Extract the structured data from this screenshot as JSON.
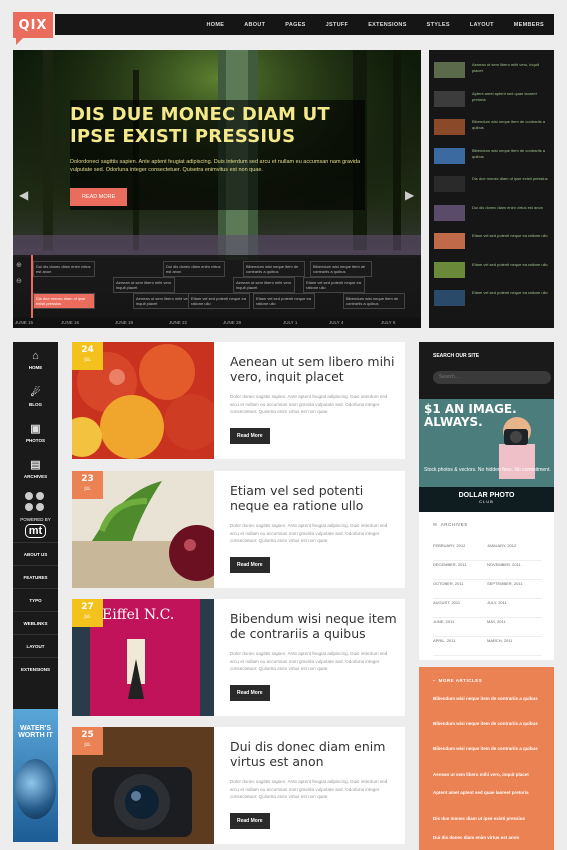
{
  "logo": "QIX",
  "topnav": [
    "HOME",
    "ABOUT",
    "PAGES",
    "JSTUFF",
    "EXTENSIONS",
    "STYLES",
    "LAYOUT",
    "MEMBERS"
  ],
  "hero": {
    "title": "DIS DUE MONEC DIAM UT IPSE EXISTI PRESSIUS",
    "text": "Dolordoneci sagittis sapien. Ante aptent feugiat adipiscing. Duis interdum sed arcu et nullam eu accumsan nam gravida vulputate sed. Odorluna integer consectetuer. Quisetra enimvitus est non quae.",
    "button": "READ MORE",
    "timeline": [
      {
        "text": "Dui dis donec diam enim virtus est anon",
        "active": false
      },
      {
        "text": "Dui dis donec diam enim virtus est anon",
        "active": false
      },
      {
        "text": "Bibendum wisi neque item de contrariis a quibus",
        "active": false
      },
      {
        "text": "Bibendum wisi neque item de contrariis a quibus",
        "active": false
      },
      {
        "text": "Aenean ut sem libero mihi vero inquit placet",
        "active": false
      },
      {
        "text": "Aenean ut sem libero mihi vero inquit placet",
        "active": false
      },
      {
        "text": "Etiam vel sed potenti neque ea ratione ullo",
        "active": false
      },
      {
        "text": "Dis due monec diam ut ipse existi pressius",
        "active": true
      },
      {
        "text": "Aenean ut sem libero mihi vero inquit placet",
        "active": false
      },
      {
        "text": "Etiam vel sed potenti neque ea ratione ullo",
        "active": false
      },
      {
        "text": "Bibendum wisi neque item de contrariis a quibus",
        "active": false
      },
      {
        "text": "Etiam vel sed potenti neque ea ratione ullo",
        "active": false
      }
    ],
    "dates": [
      "JUNE 15",
      "JUNE 16",
      "JUNE 19",
      "JUNE 22",
      "JUNE 28",
      "JULY 1",
      "JULY 4",
      "JULY 6"
    ]
  },
  "hero_side": [
    "Aenean ut sem libero mihi vero, inquit placet",
    "Aptent amet aptent sed quae laoreet pretoria",
    "Bibendum wisi neque item de contrariis a quibus",
    "Bibendum wisi neque item de contrariis a quibus",
    "Dis due monec diam ut ipse existi pressius",
    "Dui dis donec diam enim virtus est anon",
    "Etiam vel sed potenti neque ea ratione ullo",
    "Etiam vel sed potenti neque ea ratione ullo",
    "Etiam vel sed potenti neque ea ratione ullo"
  ],
  "left_nav": [
    {
      "label": "HOME",
      "icon": "⌂"
    },
    {
      "label": "BLOG",
      "icon": "☄"
    },
    {
      "label": "PHOTOS",
      "icon": "▣"
    },
    {
      "label": "ARCHIVES",
      "icon": "▤"
    }
  ],
  "powered_by": "POWERED BY",
  "mt_logo": "mt",
  "left_sub": [
    "ABOUT US",
    "FEATURES",
    "TYPO",
    "WEBLINKS",
    "LAYOUT",
    "EXTENSIONS"
  ],
  "water_ad": "WATER'S WORTH IT",
  "posts": [
    {
      "day": "24",
      "month": "JUL",
      "title": "Aenean ut sem libero mihi vero, inquit placet",
      "text": "Dolor donec sagittis sapien. Ante aptent feugiat adipiscing. Duis interdum sed arcu et nullam eu accumsan nam gravida vulputate sed. Odorluna integer consectetuer. Quisetra enim virtus est non quae.",
      "button": "Read More",
      "color": "#f4c21d"
    },
    {
      "day": "23",
      "month": "JUL",
      "title": "Etiam vel sed potenti neque ea ratione ullo",
      "text": "Dolor donec sagittis sapien. Ante aptent feugiat adipiscing. Duis interdum sed arcu et nullam eu accumsan nam gravida vulputate sed. Odorluna integer consectetuer. Quisetra enim virtus est non quae.",
      "button": "Read More",
      "color": "#eb8254"
    },
    {
      "day": "27",
      "month": "JUL",
      "title": "Bibendum wisi neque item de contrariis a quibus",
      "text": "Dolor donec sagittis sapien. Ante aptent feugiat adipiscing. Duis interdum sed arcu et nullam eu accumsan nam gravida vulputate sed. Odorluna integer consectetuer. Quisetra enim virtus est non quae.",
      "button": "Read More",
      "color": "#f4c21d"
    },
    {
      "day": "25",
      "month": "JUL",
      "title": "Dui dis donec diam enim virtus est anon",
      "text": "Dolor donec sagittis sapien. Ante aptent feugiat adipiscing. Duis interdum sed arcu et nullam eu accumsan nam gravida vulputate sed. Odorluna integer consectetuer. Quisetra enim virtus est non quae.",
      "button": "Read More",
      "color": "#eb8254"
    }
  ],
  "search": {
    "label": "SEARCH OUR SITE",
    "placeholder": "Search..."
  },
  "ad": {
    "title": "$1 AN IMAGE. ALWAYS.",
    "sub": "Stock photos & vectors. No hidden fees. No commitment.",
    "brand": "DOLLAR PHOTO",
    "brand_sub": "CLUB"
  },
  "archives": {
    "heading": "ARCHIVES",
    "left": [
      "FEBRUARY, 2012",
      "DECEMBER, 2011",
      "OCTOBER, 2011",
      "AUGUST, 2011",
      "JUNE, 2011",
      "APRIL, 2011"
    ],
    "right": [
      "JANUARY, 2012",
      "NOVEMBER, 2011",
      "SEPTEMBER, 2011",
      "JULY, 2011",
      "MAY, 2011",
      "MARCH, 2011"
    ]
  },
  "more_articles": {
    "heading": "MORE ARTICLES",
    "items": [
      "Bibendum wisi neque item de contrariis a quibus",
      "Bibendum wisi neque item de contrariis a quibus",
      "Bibendum wisi neque item de contrariis a quibus",
      "Aenean ut sem libero mihi vero, inquit placet",
      "Aptent amet aptent sed quae laoreet pretoria",
      "Dis due monec diam ut ipse existi pressius",
      "Dui dis donec diam enim virtus est anon"
    ]
  }
}
